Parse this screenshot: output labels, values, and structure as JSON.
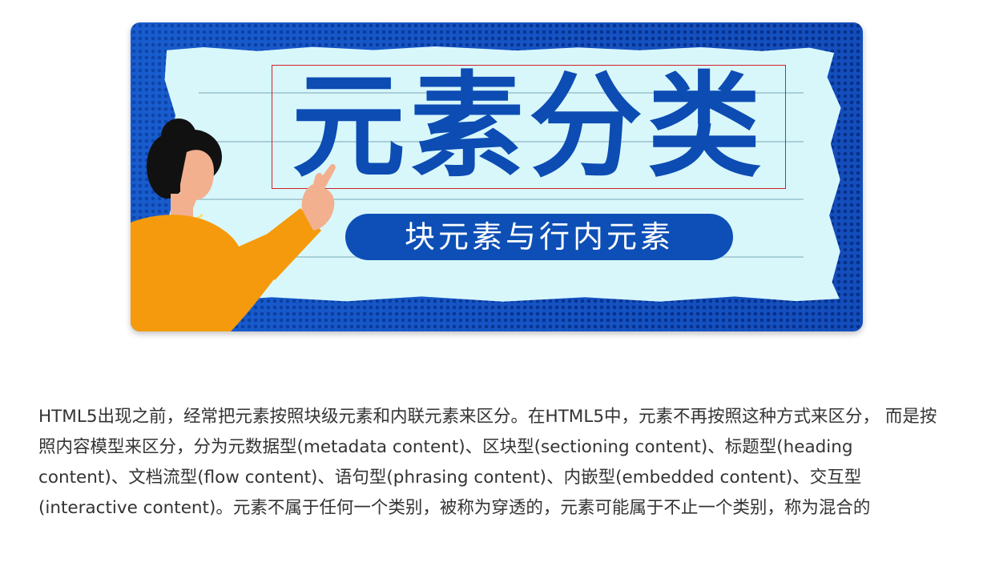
{
  "banner": {
    "title": "元素分类",
    "subtitle": "块元素与行内元素"
  },
  "article": {
    "paragraph": "HTML5出现之前，经常把元素按照块级元素和内联元素来区分。在HTML5中，元素不再按照这种方式来区分， 而是按照内容模型来区分，分为元数据型(metadata content)、区块型(sectioning content)、标题型(heading content)、文档流型(flow content)、语句型(phrasing content)、内嵌型(embedded content)、交互型 (interactive content)。元素不属于任何一个类别，被称为穿透的，元素可能属于不止一个类别，称为混合的"
  },
  "colors": {
    "banner_blue": "#1553c2",
    "dots": "#062f8a",
    "paper": "#d8f7fb",
    "title_blue": "#0c4cb3",
    "highlight_border": "#d0202a",
    "shirt_orange": "#f59a0c",
    "text": "#333333"
  }
}
